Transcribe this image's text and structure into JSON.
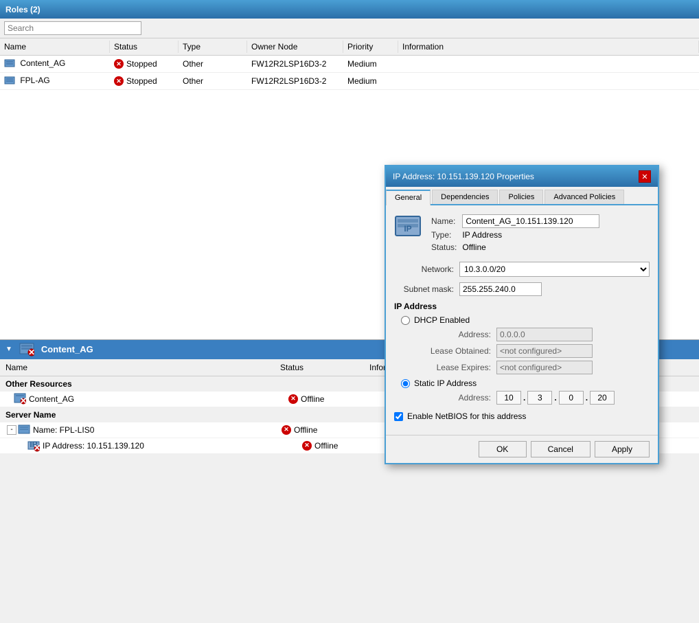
{
  "title_bar": {
    "label": "Roles (2)"
  },
  "search": {
    "placeholder": "Search"
  },
  "columns": {
    "name": "Name",
    "status": "Status",
    "type": "Type",
    "owner_node": "Owner Node",
    "priority": "Priority",
    "information": "Information"
  },
  "roles": [
    {
      "name": "Content_AG",
      "status": "Stopped",
      "type": "Other",
      "owner_node": "FW12R2LSP16D3-2",
      "priority": "Medium",
      "information": ""
    },
    {
      "name": "FPL-AG",
      "status": "Stopped",
      "type": "Other",
      "owner_node": "FW12R2LSP16D3-2",
      "priority": "Medium",
      "information": ""
    }
  ],
  "bottom_panel": {
    "title": "Content_AG",
    "sections": {
      "other_resources": "Other Resources",
      "server_name": "Server Name"
    },
    "columns": {
      "name": "Name",
      "status": "Status",
      "information": "Information"
    },
    "resources": [
      {
        "name": "Content_AG",
        "status": "Offline"
      }
    ],
    "servers": [
      {
        "name": "Name: FPL-LIS0",
        "status": "Offline",
        "children": [
          {
            "name": "IP Address: 10.151.139.120",
            "status": "Offline"
          }
        ]
      }
    ]
  },
  "dialog": {
    "title": "IP Address: 10.151.139.120 Properties",
    "tabs": [
      "General",
      "Dependencies",
      "Policies",
      "Advanced Policies"
    ],
    "active_tab": "General",
    "fields": {
      "name_label": "Name:",
      "name_value": "Content_AG_10.151.139.120",
      "type_label": "Type:",
      "type_value": "IP Address",
      "status_label": "Status:",
      "status_value": "Offline",
      "network_label": "Network:",
      "network_value": "10.3.0.0/20",
      "subnet_label": "Subnet mask:",
      "subnet_value": "255.255.240.0",
      "ip_address_section": "IP Address",
      "dhcp_label": "DHCP Enabled",
      "address_label": "Address:",
      "address_value": "0.0.0.0",
      "lease_obtained_label": "Lease Obtained:",
      "lease_obtained_value": "<not configured>",
      "lease_expires_label": "Lease Expires:",
      "lease_expires_value": "<not configured>",
      "static_label": "Static IP Address",
      "static_address_label": "Address:",
      "static_ip1": "10",
      "static_ip2": "3",
      "static_ip3": "0",
      "static_ip4": "20",
      "enable_netbios_label": "Enable NetBIOS for this address"
    },
    "buttons": {
      "ok": "OK",
      "cancel": "Cancel",
      "apply": "Apply"
    }
  }
}
